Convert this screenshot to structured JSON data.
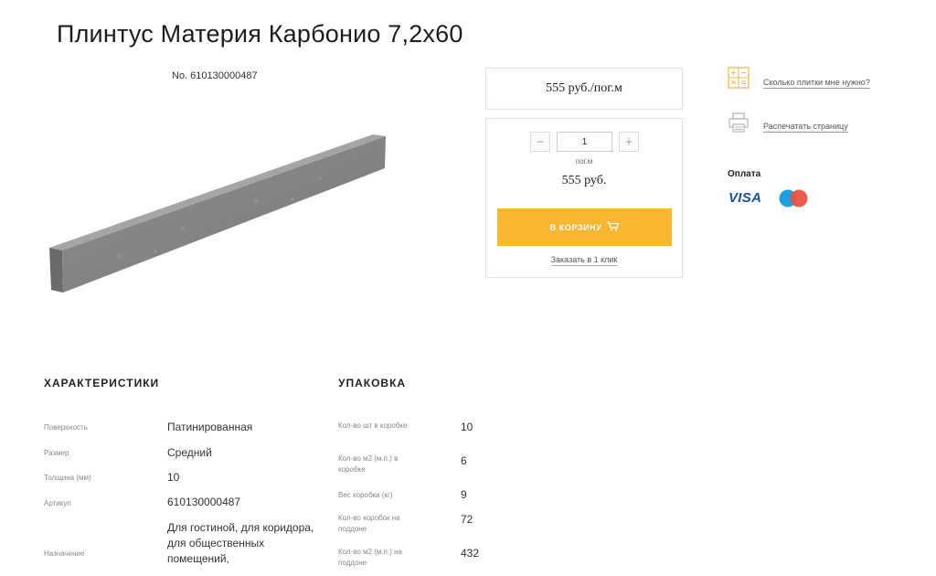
{
  "product": {
    "title": "Плинтус Материя Карбонио 7,2х60",
    "sku": "No. 610130000487",
    "price": "555 руб./пог.м",
    "quantity": "1",
    "unit": "пог.м",
    "total": "555 руб.",
    "cart_button": "В КОРЗИНУ",
    "one_click": "Заказать в 1 клик"
  },
  "side": {
    "calc_link": "Сколько плитки мне нужно?",
    "print_link": "Распечатать страницу",
    "payment_title": "Оплата",
    "visa": "VISA"
  },
  "characteristics": {
    "title": "ХАРАКТЕРИСТИКИ",
    "rows": [
      {
        "label": "Поверхность",
        "value": "Патинированная"
      },
      {
        "label": "Размер",
        "value": "Средний"
      },
      {
        "label": "Толщина (мм)",
        "value": "10"
      },
      {
        "label": "Артикул",
        "value": "610130000487"
      },
      {
        "label": "Назначение",
        "value": "Для гостиной, для коридора, для общественных помещений,"
      }
    ]
  },
  "packing": {
    "title": "УПАКОВКА",
    "rows": [
      {
        "label": "Кол-во шт в коробке",
        "value": "10"
      },
      {
        "label": "Кол-во м2 (м.п.) в коробке",
        "value": "6"
      },
      {
        "label": "Вес коробки (кг)",
        "value": "9"
      },
      {
        "label": "Кол-во коробок на поддоне",
        "value": "72"
      },
      {
        "label": "Кол-во м2 (м.п.) на поддоне",
        "value": "432"
      }
    ]
  },
  "colors": {
    "accent": "#f9b631",
    "mastercard_red": "#eb4f3f",
    "mastercard_blue": "#1d9fe0",
    "visa_blue": "#1a4fa3"
  }
}
